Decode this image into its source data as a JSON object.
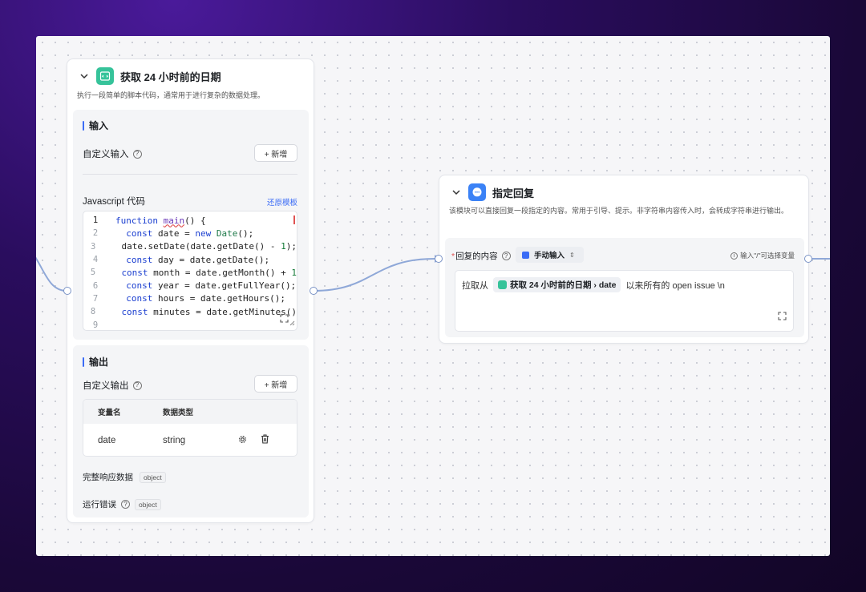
{
  "colors": {
    "accent": "#3b6cf6",
    "code_icon": "#36c39a",
    "reply_icon": "#3b82f6",
    "edge": "#8fa8d8"
  },
  "code_node": {
    "title": "获取 24 小时前的日期",
    "description": "执行一段简单的脚本代码，通常用于进行复杂的数据处理。",
    "input": {
      "section_title": "输入",
      "custom_input_label": "自定义输入",
      "add_button": "+ 新增",
      "code_label": "Javascript 代码",
      "restore_template": "还原模板",
      "lines": [
        {
          "n": "1"
        },
        {
          "n": "2"
        },
        {
          "n": "3"
        },
        {
          "n": "4"
        },
        {
          "n": "5"
        },
        {
          "n": "6"
        },
        {
          "n": "7"
        },
        {
          "n": "8"
        },
        {
          "n": "9"
        }
      ]
    },
    "output": {
      "section_title": "输出",
      "custom_output_label": "自定义输出",
      "add_button": "+ 新增",
      "col_name": "变量名",
      "col_type": "数据类型",
      "row_name": "date",
      "row_type": "string",
      "full_response_label": "完整响应数据",
      "full_response_type": "object",
      "runtime_error_label": "运行错误",
      "runtime_error_type": "object"
    }
  },
  "reply_node": {
    "title": "指定回复",
    "description": "该模块可以直接回复一段指定的内容。常用于引导、提示。非字符串内容传入时，会转成字符串进行输出。",
    "content_label": "回复的内容",
    "mode_label": "手动输入",
    "hint": "输入\"/\"可选择变量",
    "text_prefix": "拉取从",
    "chip_label": "获取 24 小时前的日期 › date",
    "text_suffix": "以来所有的 open issue \\n"
  }
}
